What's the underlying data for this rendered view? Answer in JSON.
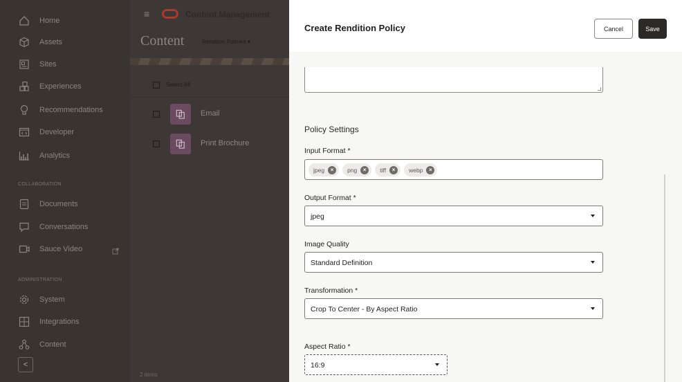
{
  "sidebar": {
    "items": [
      {
        "label": "Home",
        "icon": "home-icon"
      },
      {
        "label": "Assets",
        "icon": "assets-icon"
      },
      {
        "label": "Sites",
        "icon": "sites-icon"
      },
      {
        "label": "Experiences",
        "icon": "experiences-icon"
      },
      {
        "label": "Recommendations",
        "icon": "recommendations-icon"
      },
      {
        "label": "Developer",
        "icon": "developer-icon"
      },
      {
        "label": "Analytics",
        "icon": "analytics-icon"
      }
    ],
    "collaboration_header": "COLLABORATION",
    "collaboration_items": [
      {
        "label": "Documents",
        "icon": "documents-icon"
      },
      {
        "label": "Conversations",
        "icon": "conversations-icon"
      },
      {
        "label": "Sauce Video",
        "icon": "video-icon"
      }
    ],
    "administration_header": "ADMINISTRATION",
    "administration_items": [
      {
        "label": "System",
        "icon": "system-gear-icon"
      },
      {
        "label": "Integrations",
        "icon": "integrations-icon"
      },
      {
        "label": "Content",
        "icon": "content-icon"
      }
    ],
    "collapse_glyph": "<"
  },
  "content_panel": {
    "app_title": "Content Management",
    "page_title": "Content",
    "dropdown_label": "Rendition Policies ▾",
    "select_all": "Select All",
    "rows": [
      "Email",
      "Print Brochure"
    ],
    "count": "2 items"
  },
  "drawer": {
    "title": "Create Rendition Policy",
    "cancel_label": "Cancel",
    "save_label": "Save",
    "section_title": "Policy Settings",
    "input_format": {
      "label": "Input Format *",
      "chips": [
        "jpeg",
        "png",
        "tiff",
        "webp"
      ]
    },
    "output_format": {
      "label": "Output Format *",
      "value": "jpeg"
    },
    "image_quality": {
      "label": "Image Quality",
      "value": "Standard Definition"
    },
    "transformation": {
      "label": "Transformation *",
      "value": "Crop To Center - By Aspect Ratio"
    },
    "aspect_ratio": {
      "label": "Aspect Ratio *",
      "value": "16:9"
    }
  },
  "colors": {
    "accent_logo": "#a93a2e",
    "save_button": "#2c2a28",
    "thumb": "#6b4b60"
  }
}
